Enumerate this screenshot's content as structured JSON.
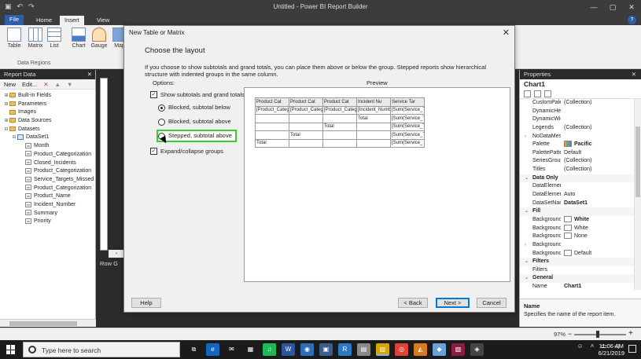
{
  "window": {
    "title": "Untitled - Power BI Report Builder",
    "minimize": "—",
    "maximize": "▢",
    "close": "✕",
    "help": "?"
  },
  "ribbon": {
    "tabs": [
      "File",
      "Home",
      "Insert",
      "View"
    ],
    "buttons": [
      "Table",
      "Matrix",
      "List",
      "Chart",
      "Gauge",
      "Map"
    ],
    "group_label": "Data Regions"
  },
  "report_data": {
    "title": "Report Data",
    "close": "✕",
    "toolbar": {
      "new": "New",
      "edit": "Edit...",
      "delete": "✕"
    },
    "tree": [
      {
        "label": "Built-in Fields",
        "kind": "folder",
        "expander": "⊞",
        "level": 0
      },
      {
        "label": "Parameters",
        "kind": "folder",
        "expander": "⊞",
        "level": 0
      },
      {
        "label": "Images",
        "kind": "folder",
        "expander": "",
        "level": 0
      },
      {
        "label": "Data Sources",
        "kind": "folder",
        "expander": "⊞",
        "level": 0
      },
      {
        "label": "Datasets",
        "kind": "folder",
        "expander": "⊟",
        "level": 0
      },
      {
        "label": "DataSet1",
        "kind": "dataset",
        "expander": "⊟",
        "level": 1
      },
      {
        "label": "Month",
        "kind": "field",
        "expander": "",
        "level": 2
      },
      {
        "label": "Product_Categorization",
        "kind": "field",
        "expander": "",
        "level": 2
      },
      {
        "label": "Closed_Incidents",
        "kind": "field",
        "expander": "",
        "level": 2
      },
      {
        "label": "Product_Categorization",
        "kind": "field",
        "expander": "",
        "level": 2
      },
      {
        "label": "Service_Targets_Missed",
        "kind": "field",
        "expander": "",
        "level": 2
      },
      {
        "label": "Product_Categorization",
        "kind": "field",
        "expander": "",
        "level": 2
      },
      {
        "label": "Product_Name",
        "kind": "field",
        "expander": "",
        "level": 2
      },
      {
        "label": "Incident_Number",
        "kind": "field",
        "expander": "",
        "level": 2
      },
      {
        "label": "Summary",
        "kind": "field",
        "expander": "",
        "level": 2
      },
      {
        "label": "Priority",
        "kind": "field",
        "expander": "",
        "level": 2
      }
    ]
  },
  "canvas": {
    "row_groups": "Row G"
  },
  "dialog": {
    "title": "New Table or Matrix",
    "close": "✕",
    "heading": "Choose the layout",
    "intro": "If you choose to show subtotals and grand totals, you can place them above or below the group. Stepped reports show hierarchical structure with indented groups in the same column.",
    "options_label": "Options:",
    "preview_label": "Preview",
    "show_subtotals": {
      "label": "Show subtotals and grand totals",
      "checked": true
    },
    "radios": [
      {
        "label": "Blocked, subtotal below",
        "selected": true,
        "highlighted": false
      },
      {
        "label": "Blocked, subtotal above",
        "selected": false,
        "highlighted": false
      },
      {
        "label": "Stepped, subtotal above",
        "selected": false,
        "highlighted": true
      }
    ],
    "expand_collapse": {
      "label": "Expand/collapse groups",
      "checked": true
    },
    "preview_table": [
      [
        "Product Cat",
        "Product Cat",
        "Product Cat",
        "Incident Nu",
        "Service Tar"
      ],
      [
        "[Product_Categ",
        "[Product_Categ",
        "[Product_Categ",
        "[Incident_Numb",
        "[Sum(Service_T"
      ],
      [
        "",
        "",
        "",
        "Total",
        "[Sum(Service_T"
      ],
      [
        "",
        "",
        "Total",
        "",
        "[Sum(Service_T"
      ],
      [
        "",
        "Total",
        "",
        "",
        "[Sum(Service_T"
      ],
      [
        "Total",
        "",
        "",
        "",
        "[Sum(Service_"
      ]
    ],
    "buttons": {
      "help": "Help",
      "back": "< Back",
      "next": "Next >",
      "cancel": "Cancel"
    }
  },
  "properties": {
    "title": "Properties",
    "close": "✕",
    "object": "Chart1",
    "rows": [
      {
        "name": "CustomPalette",
        "value": "(Collection)",
        "type": "prop"
      },
      {
        "name": "DynamicHeight",
        "value": "",
        "type": "prop"
      },
      {
        "name": "DynamicWidth",
        "value": "",
        "type": "prop"
      },
      {
        "name": "Legends",
        "value": "(Collection)",
        "type": "prop"
      },
      {
        "name": "NoDataMessage",
        "value": "",
        "type": "prop",
        "expander": "›"
      },
      {
        "name": "Palette",
        "value": "Pacific",
        "type": "prop",
        "swatch": "pac",
        "bold": true
      },
      {
        "name": "PalettePattern",
        "value": "Default",
        "type": "prop"
      },
      {
        "name": "SeriesGroups",
        "value": "(Collection)",
        "type": "prop"
      },
      {
        "name": "Titles",
        "value": "(Collection)",
        "type": "prop"
      },
      {
        "name": "Data Only",
        "value": "",
        "type": "cat",
        "expander": "⌄"
      },
      {
        "name": "DataElementName",
        "value": "",
        "type": "prop"
      },
      {
        "name": "DataElementOutput",
        "value": "Auto",
        "type": "prop"
      },
      {
        "name": "DataSetName",
        "value": "DataSet1",
        "type": "prop",
        "bold": true
      },
      {
        "name": "Fill",
        "value": "",
        "type": "cat",
        "expander": "⌄"
      },
      {
        "name": "BackgroundColor",
        "value": "White",
        "type": "prop",
        "swatch": "white",
        "bold": true
      },
      {
        "name": "BackgroundGradientEndColor",
        "value": "White",
        "type": "prop",
        "swatch": "white"
      },
      {
        "name": "BackgroundGradientType",
        "value": "None",
        "type": "prop",
        "swatch": "white"
      },
      {
        "name": "BackgroundImage",
        "value": "",
        "type": "prop",
        "expander": "›"
      },
      {
        "name": "BackgroundPatternType",
        "value": "Default",
        "type": "prop",
        "swatch": "white"
      },
      {
        "name": "Filters",
        "value": "",
        "type": "cat",
        "expander": "⌄"
      },
      {
        "name": "Filters",
        "value": "",
        "type": "prop"
      },
      {
        "name": "General",
        "value": "",
        "type": "cat",
        "expander": "⌄"
      },
      {
        "name": "Name",
        "value": "Chart1",
        "type": "prop",
        "bold": true
      }
    ],
    "desc_title": "Name",
    "desc_text": "Specifies the name of the report item."
  },
  "status": {
    "zoom": "97%",
    "minus": "−",
    "plus": "+"
  },
  "taskbar": {
    "search_placeholder": "Type here to search",
    "time": "11:06 AM",
    "date": "6/21/2019",
    "apps": [
      {
        "name": "task-view",
        "glyph": "⧉",
        "color": "#1b1b1b"
      },
      {
        "name": "edge",
        "glyph": "e",
        "color": "#1565c0"
      },
      {
        "name": "mail",
        "glyph": "✉",
        "color": "#1b1b1b"
      },
      {
        "name": "store",
        "glyph": "▦",
        "color": "#1b1b1b"
      },
      {
        "name": "spotify",
        "glyph": "♫",
        "color": "#1db954"
      },
      {
        "name": "word",
        "glyph": "W",
        "color": "#2b579a"
      },
      {
        "name": "globe",
        "glyph": "◉",
        "color": "#2c6fb8"
      },
      {
        "name": "app-8",
        "glyph": "▣",
        "color": "#3a5f8a"
      },
      {
        "name": "app-9",
        "glyph": "R",
        "color": "#2a78c8"
      },
      {
        "name": "app-10",
        "glyph": "▤",
        "color": "#8a8a8a"
      },
      {
        "name": "report-builder",
        "glyph": "▥",
        "color": "#d4a600",
        "active": true
      },
      {
        "name": "chrome",
        "glyph": "◎",
        "color": "#db4437"
      },
      {
        "name": "app-13",
        "glyph": "◭",
        "color": "#d97a1e"
      },
      {
        "name": "app-14",
        "glyph": "◆",
        "color": "#6aa0d8"
      },
      {
        "name": "app-15",
        "glyph": "▧",
        "color": "#8b1e3f"
      },
      {
        "name": "app-16",
        "glyph": "◈",
        "color": "#444"
      }
    ]
  }
}
